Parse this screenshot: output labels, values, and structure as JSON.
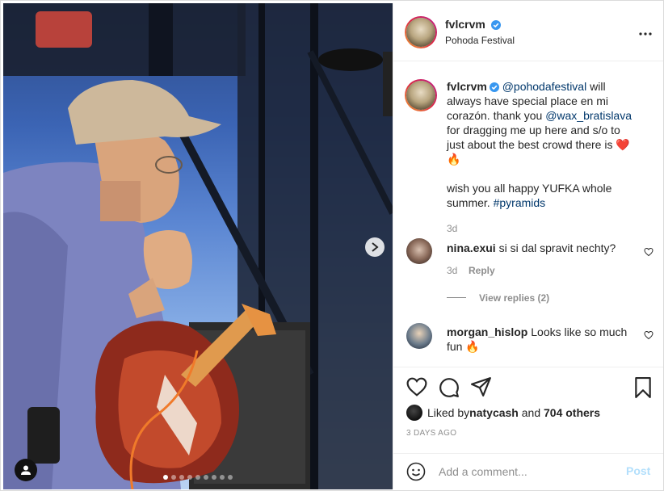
{
  "post": {
    "photo_alt": "",
    "carousel": {
      "count": 9,
      "active_index": 0
    }
  },
  "header": {
    "username": "fvlcrvm",
    "location": "Pohoda Festival",
    "more_icon": "more-horizontal-icon"
  },
  "caption": {
    "username": "fvlcrvm",
    "mention_1": "@pohodafestival",
    "text_1": " will always have special place en mi corazón. thank you ",
    "mention_2": "@wax_bratislava",
    "text_2": " for dragging me up here and s/o to just about the best crowd there is ",
    "emoji_1": "❤️🔥",
    "text_3": "wish you all happy YUFKA whole summer. ",
    "hashtag": "#pyramids",
    "age": "3d"
  },
  "comments": [
    {
      "username": "nina.exui",
      "text": "si si dal spravit nechty?",
      "age": "3d",
      "reply_label": "Reply",
      "view_replies": "View replies (2)"
    },
    {
      "username": "morgan_hislop",
      "text": "Looks like so much fun ",
      "emoji": "🔥"
    }
  ],
  "actions": {
    "liked_by_prefix": "Liked by ",
    "liked_by_user": "natycash",
    "liked_by_and": " and ",
    "liked_by_others": "704 others",
    "timestamp": "3 DAYS AGO"
  },
  "comment_box": {
    "placeholder": "Add a comment...",
    "post_label": "Post"
  },
  "colors": {
    "verified": "#3897f0",
    "link": "#00376b",
    "post_disabled": "#b2dffc",
    "muted": "#8e8e8e"
  }
}
